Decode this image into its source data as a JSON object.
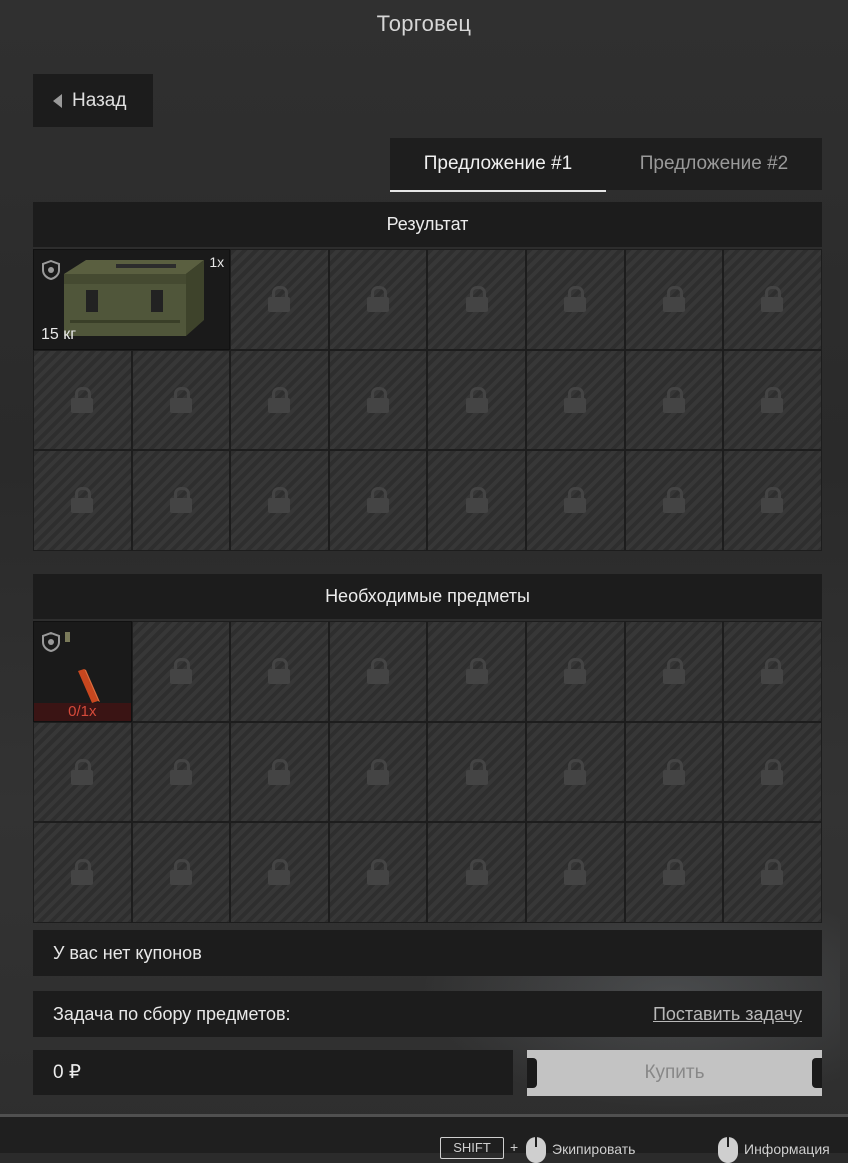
{
  "window": {
    "title": "Торговец"
  },
  "nav": {
    "back_label": "Назад"
  },
  "tabs": [
    {
      "label": "Предложение #1",
      "active": true
    },
    {
      "label": "Предложение #2",
      "active": false
    }
  ],
  "result": {
    "header": "Результат",
    "item": {
      "name": "ammo-crate",
      "quantity": "1x",
      "weight": "15 кг"
    }
  },
  "required": {
    "header": "Необходимые предметы",
    "item": {
      "name": "red-stick-item",
      "count": "0/1x"
    }
  },
  "coupons": {
    "text": "У вас нет купонов"
  },
  "task": {
    "label": "Задача по сбору предметов:",
    "link": "Поставить задачу"
  },
  "purchase": {
    "price": "0 ₽",
    "buy_label": "Купить"
  },
  "hints": {
    "key": "SHIFT",
    "plus": "+",
    "equip": "Экипировать",
    "info": "Информация"
  },
  "colors": {
    "need_red": "#d64a3a",
    "panel": "#1c1c1c"
  }
}
